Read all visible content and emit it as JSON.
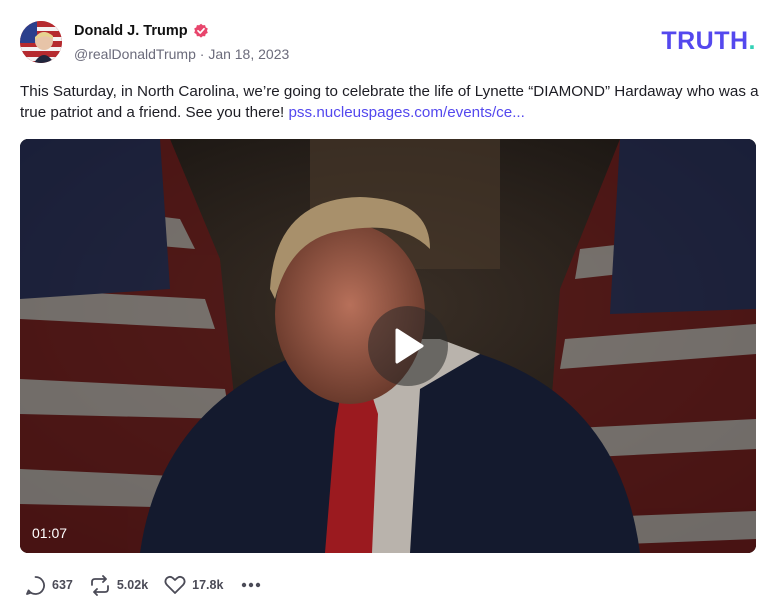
{
  "post": {
    "display_name": "Donald J. Trump",
    "handle": "@realDonaldTrump",
    "separator": "·",
    "date": "Jan 18, 2023",
    "text": "This Saturday, in North Carolina, we’re going to celebrate the life of Lynette “DIAMOND” Hardaway who was a true patriot and a friend. See you there! ",
    "link_text": "pss.nucleuspages.com/events/ce..."
  },
  "brand": {
    "logo_text": "TRUTH",
    "logo_dot": ".",
    "primary_color": "#5448ee",
    "accent_color": "#33d1b6",
    "verified_color": "#e8456c"
  },
  "video": {
    "duration": "01:07",
    "play_icon": "play-icon"
  },
  "actions": {
    "replies": "637",
    "retruths": "5.02k",
    "likes": "17.8k",
    "reply_icon": "comment-icon",
    "retruth_icon": "repost-icon",
    "like_icon": "heart-icon",
    "more_icon": "more-icon"
  }
}
